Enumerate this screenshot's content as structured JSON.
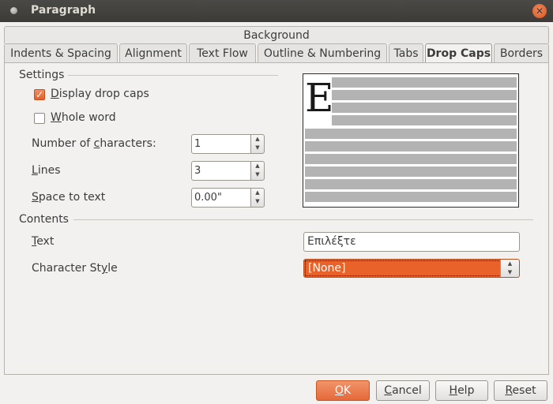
{
  "window": {
    "title": "Paragraph"
  },
  "tabs_top": {
    "background": "Background"
  },
  "tabs": [
    {
      "label": "Indents & Spacing"
    },
    {
      "label": "Alignment"
    },
    {
      "label": "Text Flow"
    },
    {
      "label": "Outline & Numbering"
    },
    {
      "label": "Tabs"
    },
    {
      "label": "Drop Caps"
    },
    {
      "label": "Borders"
    }
  ],
  "settings": {
    "heading": "Settings",
    "display_drop_caps": {
      "pre": "",
      "mn": "D",
      "post": "isplay drop caps",
      "checked": true
    },
    "whole_word": {
      "pre": "",
      "mn": "W",
      "post": "hole word",
      "checked": false
    },
    "number_of_characters": {
      "pre": "Number of ",
      "mn": "c",
      "post": "haracters:",
      "value": "1"
    },
    "lines": {
      "pre": "",
      "mn": "L",
      "post": "ines",
      "value": "3"
    },
    "space_to_text": {
      "pre": "",
      "mn": "S",
      "post": "pace to text",
      "value": "0.00\""
    }
  },
  "preview": {
    "letter": "E"
  },
  "contents": {
    "heading": "Contents",
    "text": {
      "pre": "",
      "mn": "T",
      "post": "ext",
      "value": "Επιλέξτε"
    },
    "character_style": {
      "pre": "Character St",
      "mn": "y",
      "post": "le",
      "value": "[None]"
    }
  },
  "buttons": {
    "ok": {
      "pre": "",
      "mn": "O",
      "post": "K"
    },
    "cancel": {
      "pre": "",
      "mn": "C",
      "post": "ancel"
    },
    "help": {
      "pre": "",
      "mn": "H",
      "post": "elp"
    },
    "reset": {
      "pre": "",
      "mn": "R",
      "post": "eset"
    }
  },
  "colors": {
    "accent": "#e86229",
    "titlebar": "#3c3b37"
  }
}
